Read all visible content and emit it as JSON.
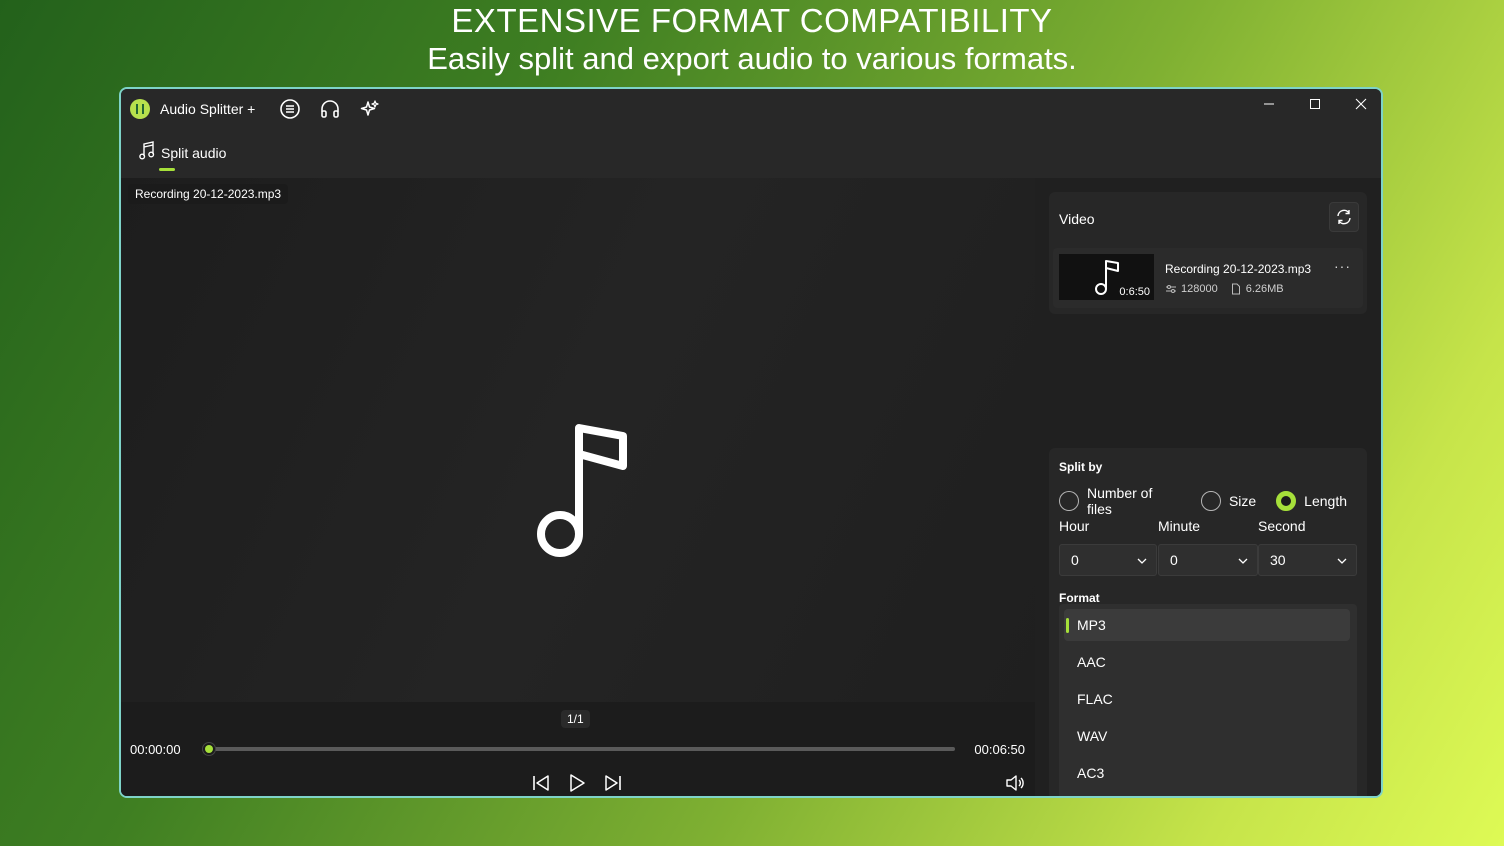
{
  "promo": {
    "headline": "EXTENSIVE FORMAT COMPATIBILITY",
    "subheadline": "Easily split and export audio to various formats."
  },
  "app": {
    "title": "Audio Splitter +",
    "toolbar_icons": [
      "list-icon",
      "headphones-icon",
      "sparkle-icon"
    ],
    "window_controls": [
      "minimize-icon",
      "maximize-icon",
      "close-icon"
    ]
  },
  "tabs": [
    {
      "label": "Split audio",
      "icon": "music-note-icon",
      "active": true
    }
  ],
  "player": {
    "file_name": "Recording 20-12-2023.mp3",
    "page_indicator": "1/1",
    "time_start": "00:00:00",
    "time_end": "00:06:50",
    "progress": 0,
    "accent_color": "#a6e03a"
  },
  "side": {
    "title": "Video",
    "media": {
      "name": "Recording 20-12-2023.mp3",
      "duration": "0:6:50",
      "bitrate": "128000",
      "size": "6.26MB"
    }
  },
  "split": {
    "section_label": "Split by",
    "options": [
      "Number of files",
      "Size",
      "Length"
    ],
    "selected": "Length",
    "fields": {
      "hour_label": "Hour",
      "hour_value": "0",
      "minute_label": "Minute",
      "minute_value": "0",
      "second_label": "Second",
      "second_value": "30"
    },
    "format_label": "Format",
    "formats": [
      "MP3",
      "AAC",
      "FLAC",
      "WAV",
      "AC3"
    ],
    "selected_format": "MP3"
  }
}
